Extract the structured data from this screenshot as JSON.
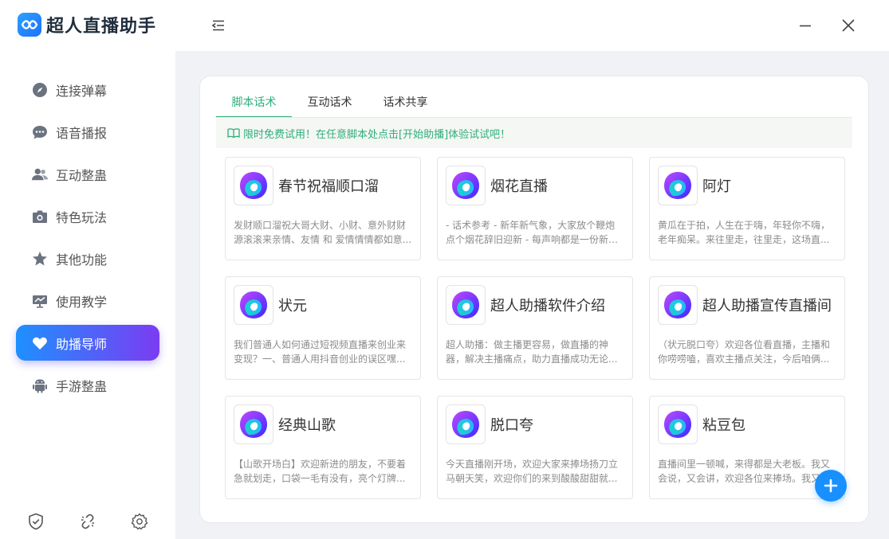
{
  "app": {
    "name": "超人直播助手"
  },
  "sidebar": {
    "items": [
      {
        "label": "连接弹幕",
        "icon": "compass-icon"
      },
      {
        "label": "语音播报",
        "icon": "chat-bubble-icon"
      },
      {
        "label": "互动整蛊",
        "icon": "users-icon"
      },
      {
        "label": "特色玩法",
        "icon": "camera-icon"
      },
      {
        "label": "其他功能",
        "icon": "star-icon"
      },
      {
        "label": "使用教学",
        "icon": "presentation-icon"
      },
      {
        "label": "助播导师",
        "icon": "heart-icon",
        "active": true
      },
      {
        "label": "手游整蛊",
        "icon": "android-icon"
      }
    ],
    "bottom_icons": [
      "shield-check-icon",
      "unlink-icon",
      "settings-icon"
    ]
  },
  "tabs": [
    {
      "label": "脚本话术",
      "active": true
    },
    {
      "label": "互动话术"
    },
    {
      "label": "话术共享"
    }
  ],
  "notice": "限时免费试用！在任意脚本处点击[开始助播]体验试试吧！",
  "scripts": [
    {
      "title": "春节祝福顺口溜",
      "desc": "发财顺口溜祝大哥大财、小财、意外财财源滚滚来亲情、友情 和 爱情情情都如意..."
    },
    {
      "title": "烟花直播",
      "desc": "- 话术参考 - 新年新气象，大家放个鞭炮点个烟花辞旧迎新 - 每声响都是一份新年..."
    },
    {
      "title": "阿灯",
      "desc": "黄瓜在于拍，人生在于嗨，年轻你不嗨，老年痴呆。来往里走，往里走，这场直..."
    },
    {
      "title": "状元",
      "desc": "我们普通人如何通过短视频直播来创业来变现？一、普通人用抖音创业的误区嘿..."
    },
    {
      "title": "超人助播软件介绍",
      "desc": "超人助播：做主播更容易，做直播的神器，解决主播痛点，助力直播成功无论..."
    },
    {
      "title": "超人助播宣传直播间",
      "desc": "（状元脱口夸）欢迎各位看直播，主播和你唠唠嗑，喜欢主播点关注，今后咱俩..."
    },
    {
      "title": "经典山歌",
      "desc": "【山歌开场白】欢迎新进的朋友，不要着急就划走，口袋一毛有没有，亮个灯牌..."
    },
    {
      "title": "脱口夸",
      "desc": "今天直播刚开场，欢迎大家来捧场扬刀立马朝天笑，欢迎你们的来到酸酸甜甜就..."
    },
    {
      "title": "粘豆包",
      "desc": "直播间里一顿喊，来得都是大老板。我又会说，又会讲，欢迎各位来捧场。我又..."
    }
  ],
  "colors": {
    "accent": "#2fae7b",
    "active_start": "#1e90ff",
    "active_end": "#7b3cf2",
    "fab": "#1890ff"
  }
}
